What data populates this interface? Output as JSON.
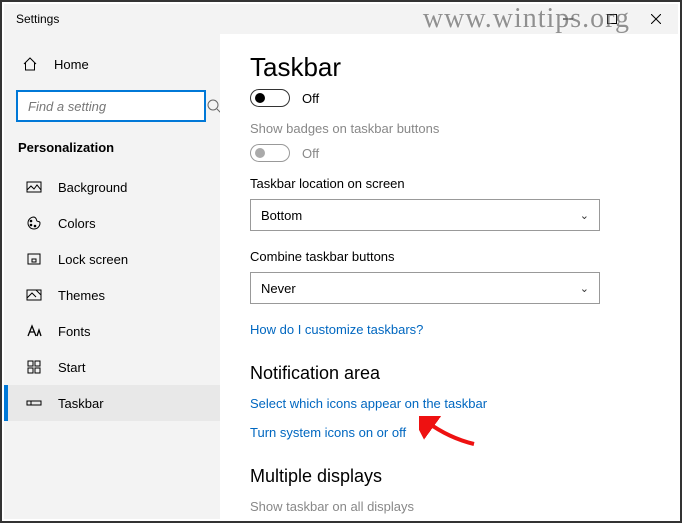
{
  "watermark": "www.wintips.org",
  "titlebar": {
    "title": "Settings"
  },
  "sidebar": {
    "home_label": "Home",
    "search_placeholder": "Find a setting",
    "category": "Personalization",
    "items": [
      {
        "label": "Background"
      },
      {
        "label": "Colors"
      },
      {
        "label": "Lock screen"
      },
      {
        "label": "Themes"
      },
      {
        "label": "Fonts"
      },
      {
        "label": "Start"
      },
      {
        "label": "Taskbar"
      }
    ]
  },
  "content": {
    "page_title": "Taskbar",
    "toggle1_label": "Off",
    "badges_label": "Show badges on taskbar buttons",
    "toggle2_label": "Off",
    "location_label": "Taskbar location on screen",
    "location_value": "Bottom",
    "combine_label": "Combine taskbar buttons",
    "combine_value": "Never",
    "customize_link": "How do I customize taskbars?",
    "notification_header": "Notification area",
    "select_icons_link": "Select which icons appear on the taskbar",
    "system_icons_link": "Turn system icons on or off",
    "multiple_header": "Multiple displays",
    "multiple_label": "Show taskbar on all displays"
  }
}
